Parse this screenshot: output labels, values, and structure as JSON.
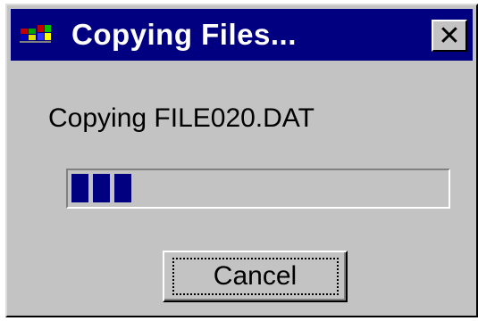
{
  "window": {
    "title": "Copying Files...",
    "close_label": "✕",
    "app_icon": "windows-logo-icon"
  },
  "status": {
    "text": "Copying FILE020.DAT"
  },
  "progress": {
    "filled_fraction": 0.19,
    "filled_segments": 3
  },
  "buttons": {
    "cancel_label": "Cancel"
  },
  "colors": {
    "titlebar": "#000080",
    "face": "#c3c3c3",
    "progress_fill": "#000080"
  }
}
